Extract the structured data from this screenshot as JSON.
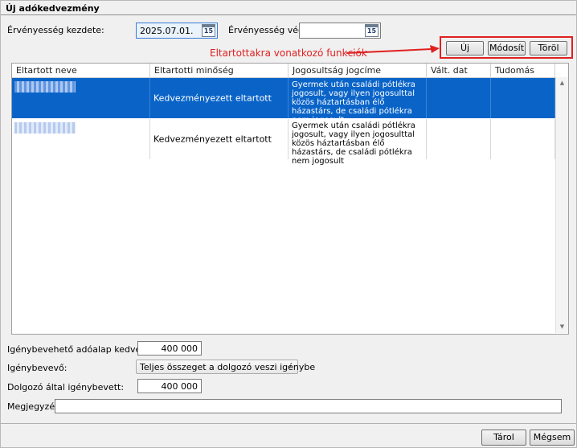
{
  "window": {
    "title": "Új adókedvezmény"
  },
  "validity": {
    "start_label": "Érvényesség kezdete:",
    "start_value": "2025.07.01.",
    "end_label": "Érvényesség vége:",
    "end_value": "",
    "calendar_badge": "15"
  },
  "annotation": {
    "text": "Eltartottakra vonatkozó funkciók",
    "color": "#e02020"
  },
  "buttons": {
    "new": "Új",
    "modify": "Módosít",
    "delete": "Töröl"
  },
  "table": {
    "columns": [
      "Eltartott neve",
      "Eltartotti minőség",
      "Jogosultság jogcíme",
      "Vált. dat",
      "Tudomás"
    ],
    "rows": [
      {
        "name": "",
        "quality": "Kedvezményezett eltartott",
        "entitlement": "Gyermek után családi pótlékra jogosult, vagy ilyen jogosulttal közös háztartásban élő házastárs, de családi pótlékra nem jogosult",
        "change_date": "",
        "knowledge": "",
        "selected": true
      },
      {
        "name": "",
        "quality": "Kedvezményezett eltartott",
        "entitlement": "Gyermek után családi pótlékra jogosult, vagy ilyen jogosulttal közös háztartásban élő házastárs, de családi pótlékra nem jogosult",
        "change_date": "",
        "knowledge": "",
        "selected": false
      }
    ]
  },
  "form": {
    "base_allowance_label": "Igénybevehető adóalap kedvezmény:",
    "base_allowance_value": "400 000",
    "claimant_label": "Igénybevevő:",
    "claimant_value": "Teljes összeget a dolgozó veszi igénybe",
    "employee_claimed_label": "Dolgozó által igénybevett:",
    "employee_claimed_value": "400 000",
    "note_label": "Megjegyzés:",
    "note_value": ""
  },
  "footer": {
    "save_label": "Tárol",
    "cancel_label": "Mégsem"
  },
  "colors": {
    "selection": "#0a64c8",
    "accent_focus": "#3a7bd5"
  }
}
